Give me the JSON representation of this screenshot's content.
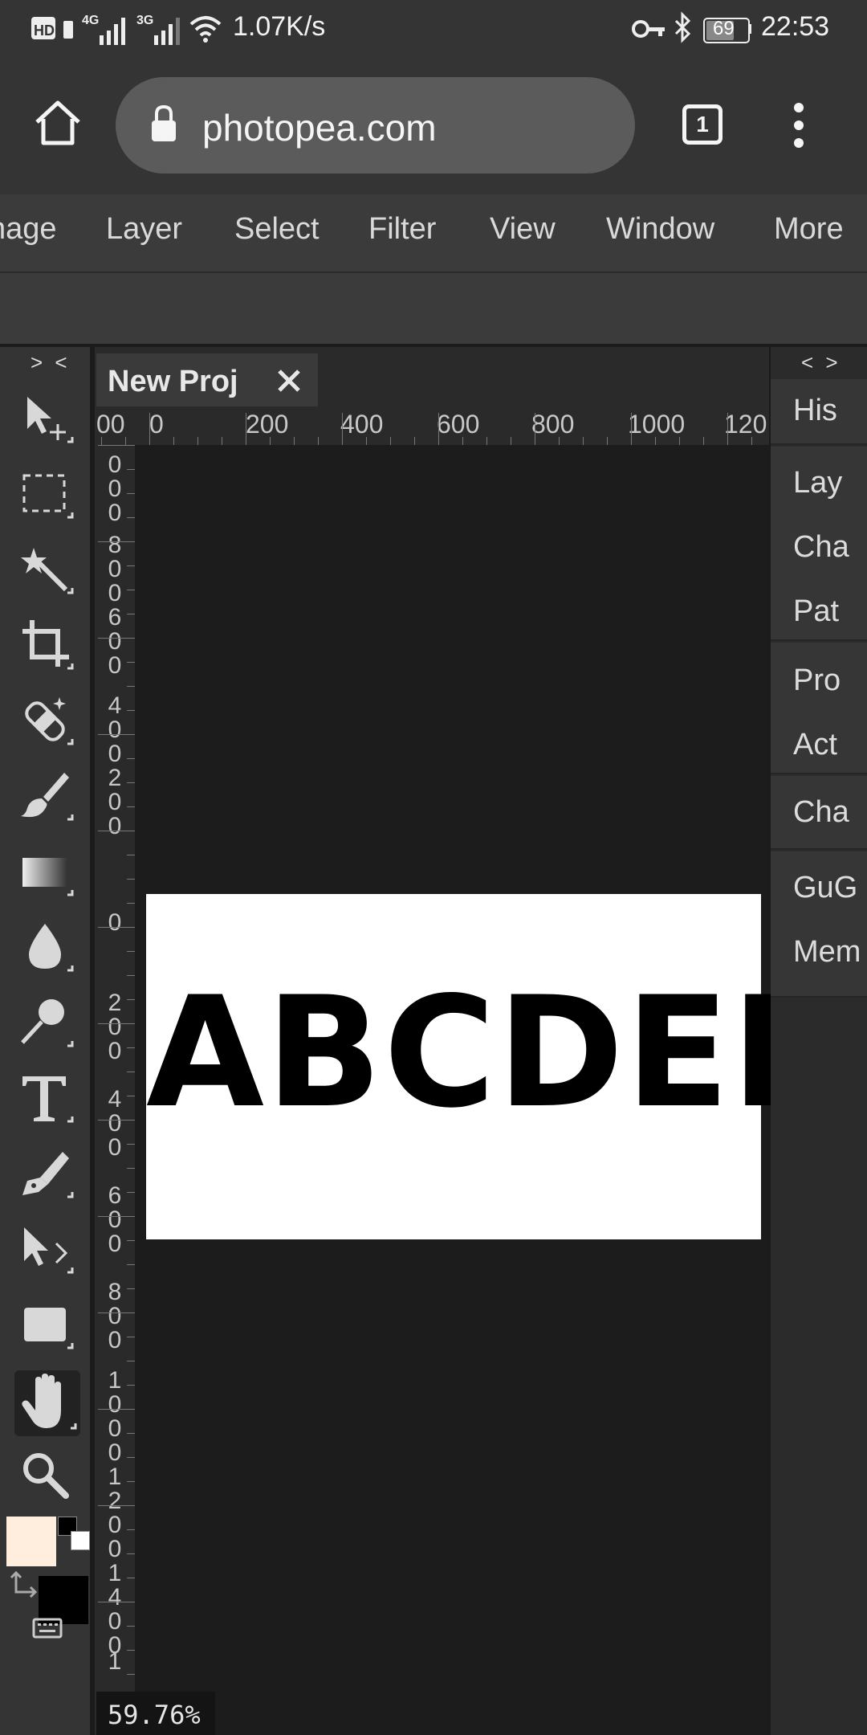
{
  "status_bar": {
    "left_icons": [
      "hd-icon",
      "4g-signal-icon",
      "3g-signal-icon",
      "wifi-icon"
    ],
    "network_speed": "1.07K/s",
    "battery": "69",
    "time": "22:53"
  },
  "browser": {
    "url": "photopea.com",
    "tab_count": "1"
  },
  "menu": {
    "items": [
      "nage",
      "Layer",
      "Select",
      "Filter",
      "View",
      "Window",
      "More"
    ]
  },
  "tools": {
    "collapse_label": "> <",
    "items": [
      "move",
      "marquee",
      "magic-wand",
      "crop",
      "healing",
      "brush",
      "gradient",
      "blur",
      "dodge",
      "type",
      "pen",
      "path-select",
      "shape",
      "hand",
      "zoom"
    ],
    "active": "hand",
    "foreground_color": "#ffeedd",
    "background_color": "#000000"
  },
  "document": {
    "tab_title": "New Proj",
    "artboard_text": "ABCDEF",
    "zoom": "59.76%",
    "ruler_top_labels": [
      "00",
      "0",
      "200",
      "400",
      "600",
      "800",
      "1000",
      "120"
    ],
    "ruler_left_labels": [
      {
        "text": "0\n0\n0",
        "y": 0
      },
      {
        "text": "8\n0\n0",
        "y": 0
      },
      {
        "text": "6\n0\n0",
        "y": 0
      },
      {
        "text": "4\n0\n0",
        "y": 0
      },
      {
        "text": "2\n0\n0",
        "y": 0
      },
      {
        "text": "0",
        "y": 0
      },
      {
        "text": "2\n0\n0",
        "y": 0
      },
      {
        "text": "4\n0\n0",
        "y": 0
      },
      {
        "text": "6\n0\n0",
        "y": 0
      },
      {
        "text": "8\n0\n0",
        "y": 0
      },
      {
        "text": "1\n0\n0\n0",
        "y": 0
      },
      {
        "text": "1\n2\n0\n0",
        "y": 0
      },
      {
        "text": "1\n4\n0\n0",
        "y": 0
      },
      {
        "text": "1",
        "y": 0
      }
    ]
  },
  "right_panel": {
    "collapse_label": "< >",
    "groups": [
      [
        "His"
      ],
      [
        "Lay",
        "Cha",
        "Pat"
      ],
      [
        "Pro",
        "Act"
      ],
      [
        "Cha"
      ],
      [
        "GuG",
        "Mem"
      ]
    ]
  }
}
